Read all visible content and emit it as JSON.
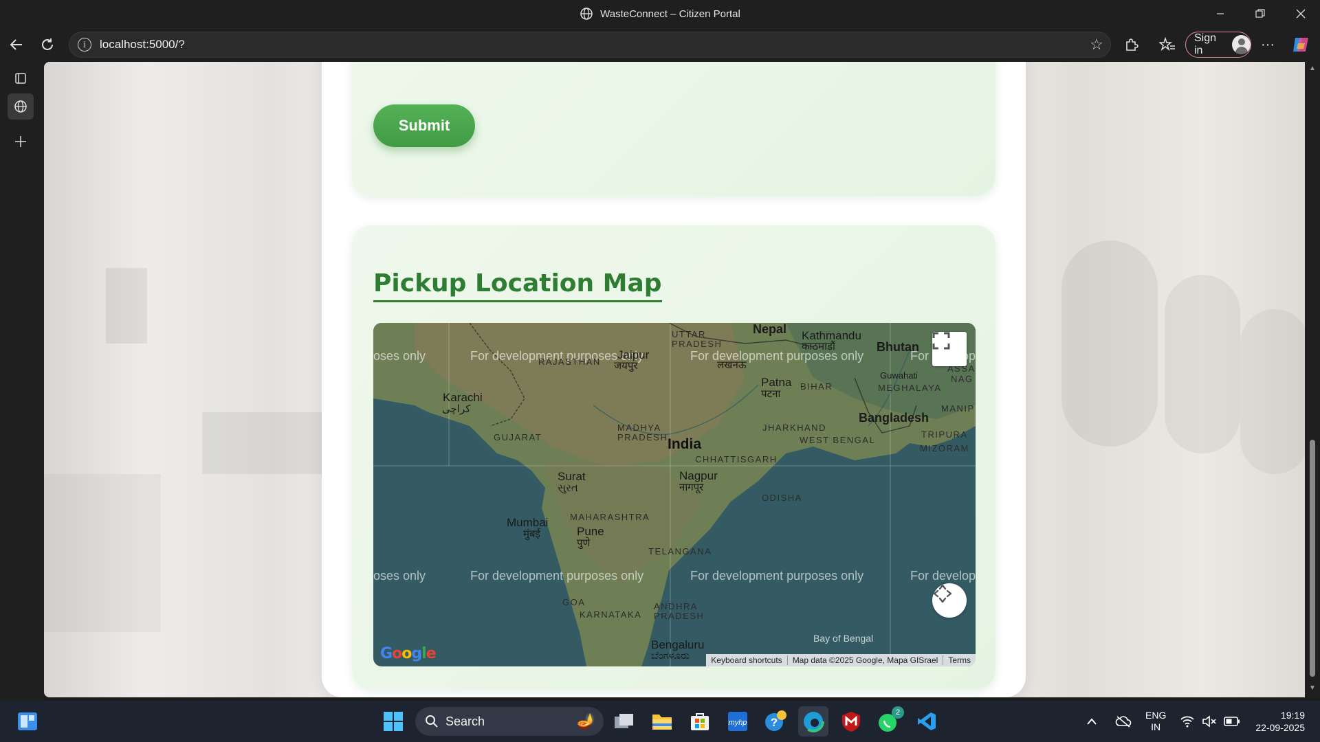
{
  "window": {
    "title": "WasteConnect – Citizen Portal"
  },
  "toolbar": {
    "url": "localhost:5000/?",
    "signin_label": "Sign in"
  },
  "page": {
    "submit_label": "Submit",
    "map_section_title": "Pickup Location Map"
  },
  "map": {
    "watermark": "For development purposes only",
    "watermark_partial_left": "oses only",
    "watermark_partial_right_1": "For develop",
    "watermark_partial_right_2": "For develop",
    "places": {
      "nepal": "Nepal",
      "kathmandu": "Kathmandu",
      "kathmandu_local": "काठमाडौं",
      "bhutan": "Bhutan",
      "uttar_pradesh": "UTTAR PRADESH",
      "lucknow_local": "लखनऊ",
      "jaipur": "Jaipur",
      "jaipur_local": "जयपुर",
      "rajasthan": "RAJASTHAN",
      "karachi": "Karachi",
      "karachi_local": "کراچی",
      "patna": "Patna",
      "patna_local": "पटना",
      "bihar": "BIHAR",
      "guwahati": "Guwahati",
      "assam": "ASSAM",
      "meghalaya": "MEGHALAYA",
      "nag": "NAG",
      "manip": "MANIP",
      "bangladesh": "Bangladesh",
      "tripura": "TRIPURA",
      "mizoram": "MIZORAM",
      "gujarat": "GUJARAT",
      "madhya_pradesh": "MADHYA PRADESH",
      "india": "India",
      "jharkhand": "JHARKHAND",
      "west_bengal": "WEST BENGAL",
      "chhattisgarh": "CHHATTISGARH",
      "surat": "Surat",
      "surat_local": "સુરત",
      "nagpur": "Nagpur",
      "nagpur_local": "नागपूर",
      "odisha": "ODISHA",
      "maharashtra": "MAHARASHTRA",
      "mumbai": "Mumbai",
      "mumbai_local": "मुंबई",
      "pune": "Pune",
      "pune_local": "पुणे",
      "telangana": "TELANGANA",
      "goa": "GOA",
      "karnataka": "KARNATAKA",
      "andhra_pradesh": "ANDHRA PRADESH",
      "bay_of_bengal": "Bay of Bengal",
      "bengaluru": "Bengaluru",
      "bengaluru_local": "ಬೆಂಗಳೂರು"
    },
    "attribution": {
      "keyboard_shortcuts": "Keyboard shortcuts",
      "map_data": "Map data ©2025 Google, Mapa GISrael",
      "terms": "Terms"
    },
    "logo_text": "Google"
  },
  "taskbar": {
    "search_label": "Search",
    "whatsapp_badge": "2",
    "language": "ENG",
    "region": "IN",
    "time": "19:19",
    "date": "22-09-2025"
  },
  "colors": {
    "accent_green": "#2e7d32",
    "button_green": "#4caf50",
    "section_bg": "#e8f5e9"
  }
}
